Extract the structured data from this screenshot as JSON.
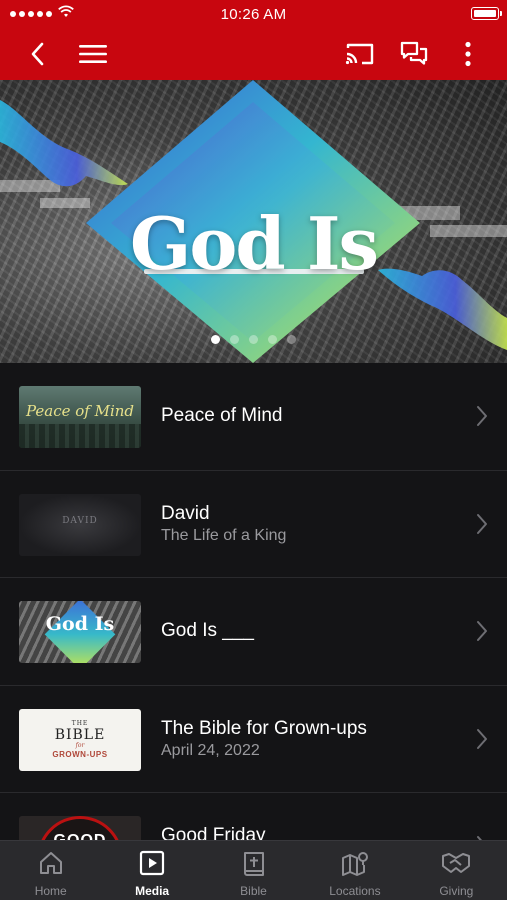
{
  "status_bar": {
    "time": "10:26 AM"
  },
  "nav": {
    "back_icon": "chevron-left-icon",
    "menu_icon": "hamburger-menu-icon",
    "cast_icon": "cast-icon",
    "chat_icon": "chat-bubbles-icon",
    "more_icon": "more-vertical-icon"
  },
  "hero": {
    "title": "God Is",
    "slide_count": 5,
    "active_slide": 1
  },
  "media_list": [
    {
      "title": "Peace of Mind",
      "subtitle": "",
      "thumb_text": "Peace of Mind"
    },
    {
      "title": "David",
      "subtitle": "The Life of a King",
      "thumb_text": "DAVID"
    },
    {
      "title": "God Is ___",
      "subtitle": "",
      "thumb_text": "God Is"
    },
    {
      "title": "The Bible for Grown-ups",
      "subtitle": "April 24, 2022",
      "thumb_text_a": "THE",
      "thumb_text_b": "BIBLE",
      "thumb_text_c": "for",
      "thumb_text_d": "GROWN-UPS"
    },
    {
      "title": "Good Friday",
      "subtitle": "",
      "thumb_text": "GOOD"
    }
  ],
  "tabs": [
    {
      "label": "Home",
      "icon": "home-icon",
      "active": false
    },
    {
      "label": "Media",
      "icon": "play-square-icon",
      "active": true
    },
    {
      "label": "Bible",
      "icon": "bible-icon",
      "active": false
    },
    {
      "label": "Locations",
      "icon": "map-pin-icon",
      "active": false
    },
    {
      "label": "Giving",
      "icon": "handshake-icon",
      "active": false
    }
  ],
  "colors": {
    "brand_red": "#c8060f",
    "background": "#141416",
    "tabbar": "#2a2a2d",
    "active_tab": "#ffffff",
    "inactive_tab": "#8e8e93"
  }
}
